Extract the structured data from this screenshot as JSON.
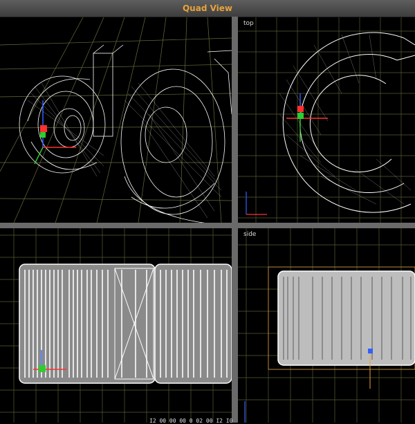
{
  "window": {
    "title": "Quad View"
  },
  "viewports": {
    "top_left": {
      "label": ""
    },
    "top_right": {
      "label": "top"
    },
    "bottom_left": {
      "label": ""
    },
    "bottom_right": {
      "label": "side"
    }
  },
  "status": {
    "text": "I2 00 00 00 0  02 00 I2 I0"
  },
  "colors": {
    "title_text": "#e8a33a",
    "grid_line": "#5a5a36",
    "wireframe": "#ffffff",
    "axis_x": "#ff3030",
    "axis_y": "#2ecc2e",
    "axis_z": "#3060ff",
    "frame_box": "#b98a3a"
  }
}
